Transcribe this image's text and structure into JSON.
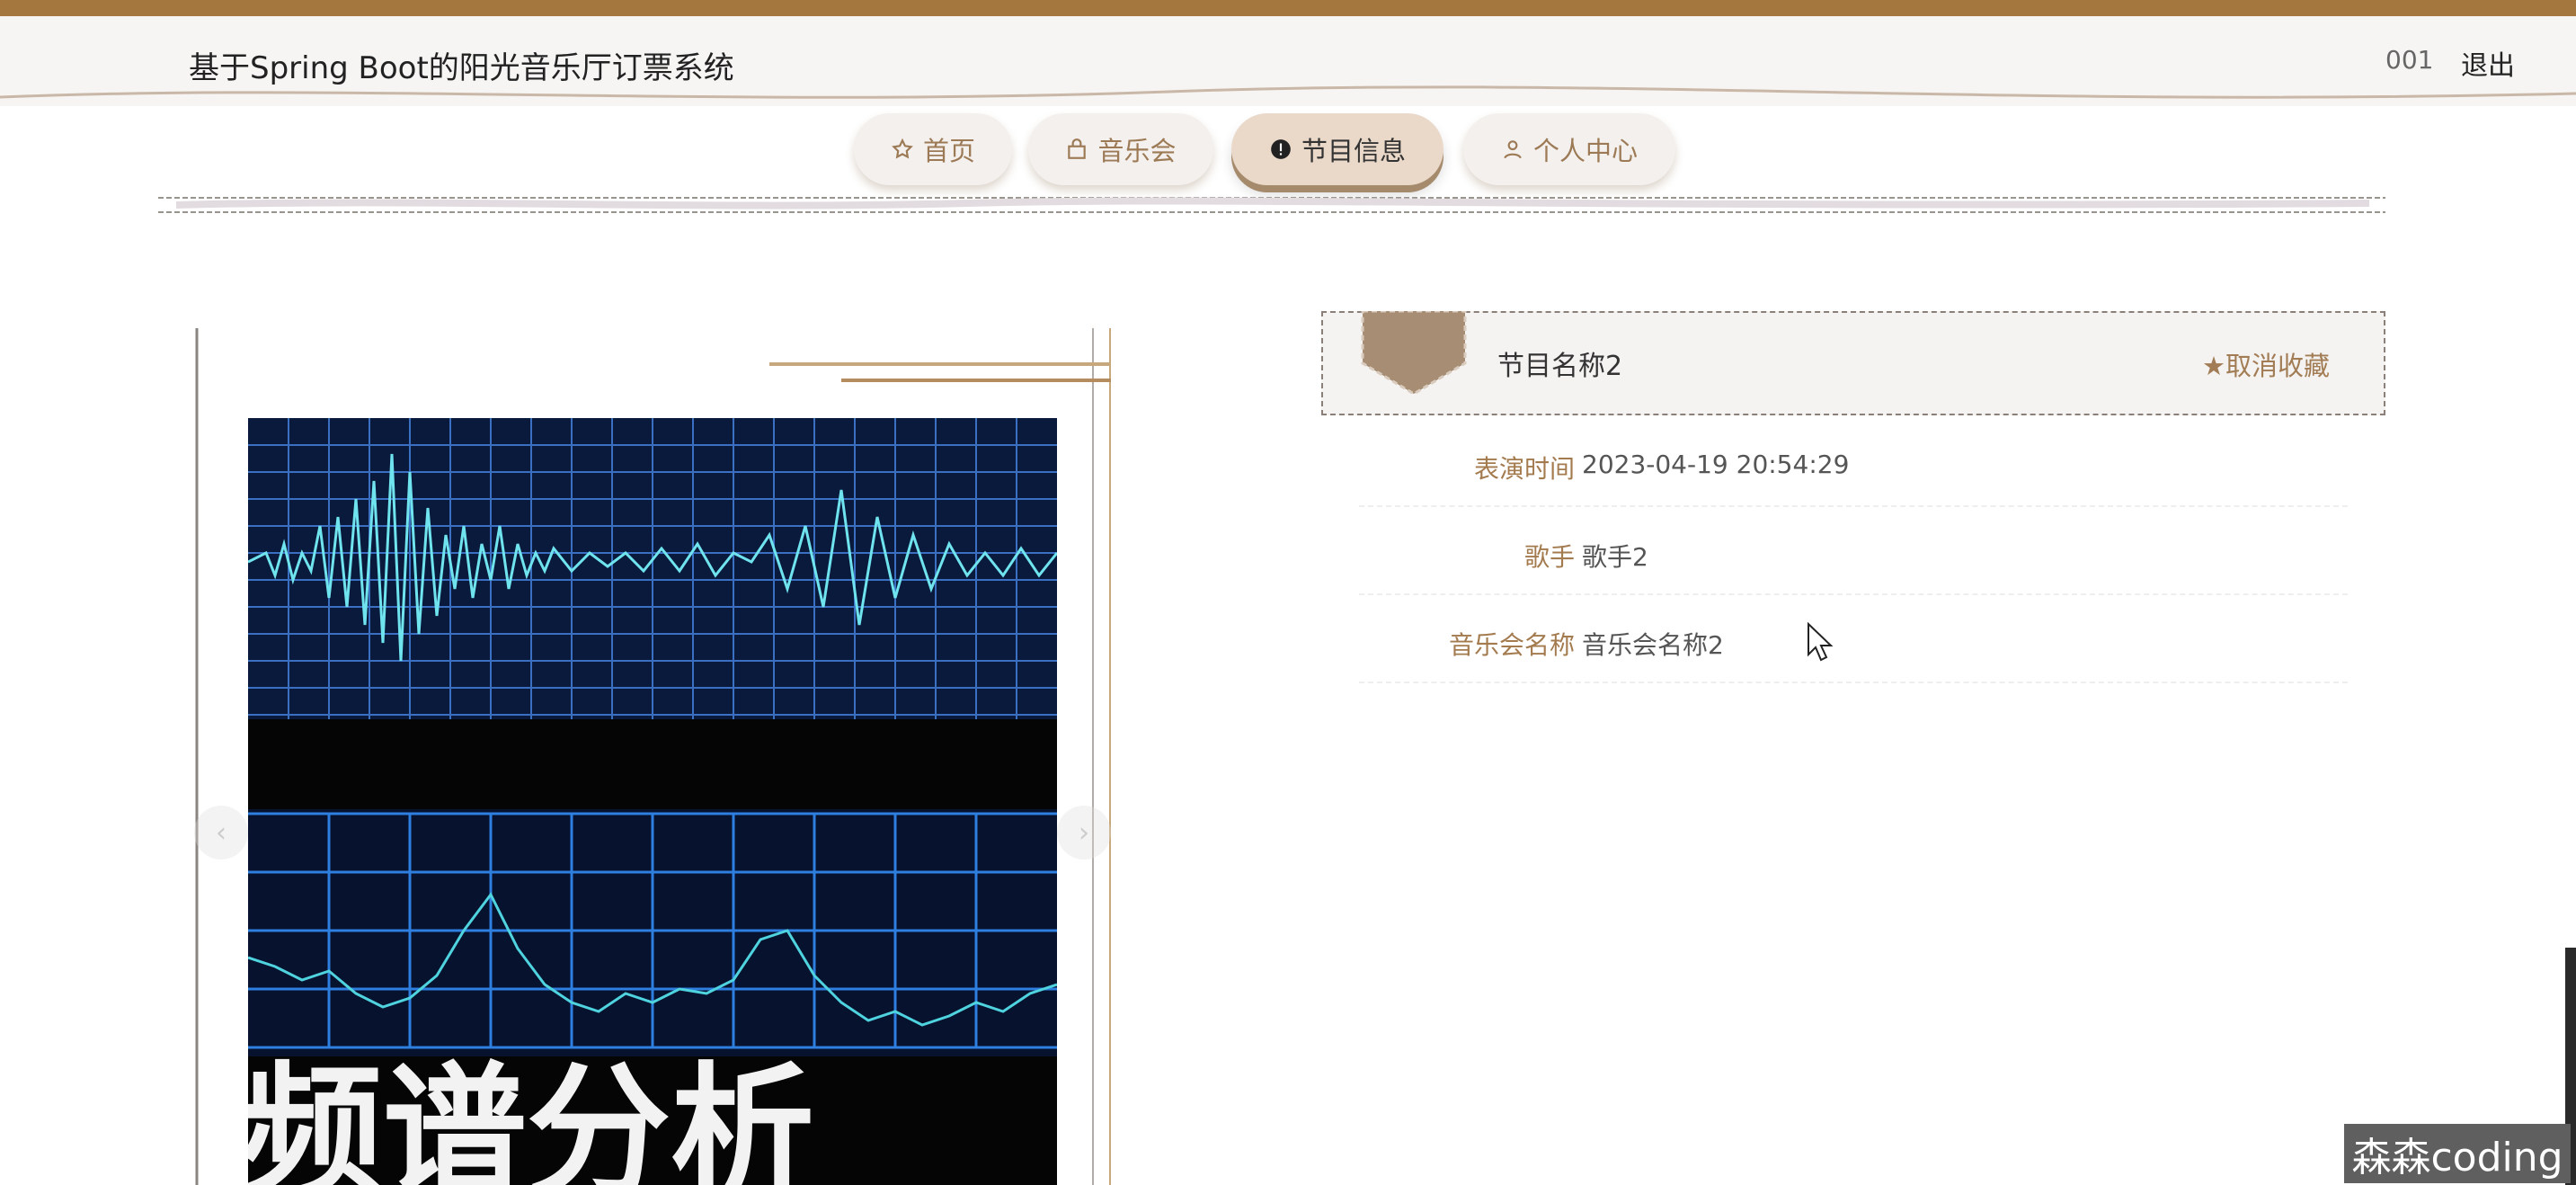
{
  "header": {
    "title": "基于Spring Boot的阳光音乐厅订票系统",
    "user": "001",
    "logout": "退出"
  },
  "nav": {
    "items": [
      {
        "label": "首页",
        "icon": "star-outline-icon"
      },
      {
        "label": "音乐会",
        "icon": "bag-icon"
      },
      {
        "label": "节目信息",
        "icon": "info-circle-icon",
        "active": true
      },
      {
        "label": "个人中心",
        "icon": "user-icon"
      }
    ]
  },
  "detail": {
    "title": "节目名称2",
    "favorite_label": "取消收藏",
    "fields": [
      {
        "label": "表演时间",
        "value": "2023-04-19 20:54:29"
      },
      {
        "label": "歌手",
        "value": "歌手2"
      },
      {
        "label": "音乐会名称",
        "value": "音乐会名称2"
      }
    ]
  },
  "slider": {
    "prev": "‹",
    "next": "›",
    "image_caption": "频谱分析"
  },
  "watermark": "森森coding",
  "colors": {
    "accent_brown": "#a4773f",
    "label_brown": "#a47b4f",
    "shield": "#a68d73"
  }
}
